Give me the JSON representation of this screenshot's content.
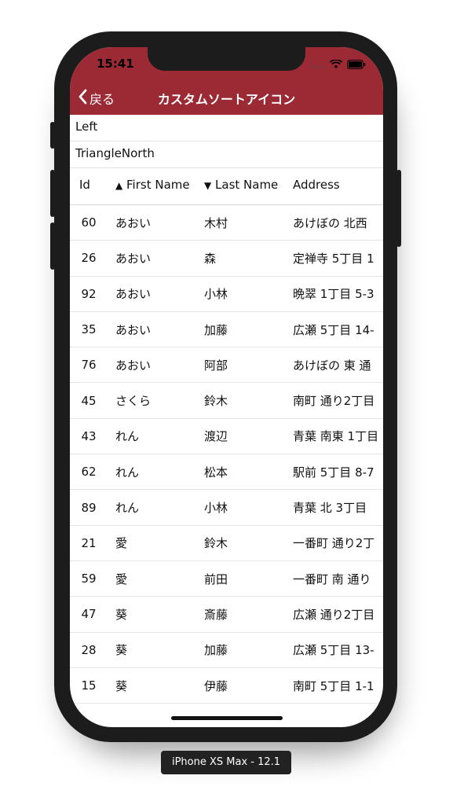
{
  "status": {
    "time": "15:41"
  },
  "nav": {
    "back_label": "戻る",
    "title": "カスタムソートアイコン"
  },
  "options": {
    "position": "Left",
    "icon": "TriangleNorth"
  },
  "table": {
    "headers": {
      "id": "Id",
      "first_arrow": "▲",
      "first": "First Name",
      "last_arrow": "▼",
      "last": "Last Name",
      "address": "Address"
    },
    "rows": [
      {
        "id": "60",
        "first": "あおい",
        "last": "木村",
        "address": "あけぼの 北西"
      },
      {
        "id": "26",
        "first": "あおい",
        "last": "森",
        "address": "定禅寺 5丁目 1"
      },
      {
        "id": "92",
        "first": "あおい",
        "last": "小林",
        "address": "晩翠 1丁目 5-3"
      },
      {
        "id": "35",
        "first": "あおい",
        "last": "加藤",
        "address": "広瀬 5丁目 14-"
      },
      {
        "id": "76",
        "first": "あおい",
        "last": "阿部",
        "address": "あけぼの 東 通"
      },
      {
        "id": "45",
        "first": "さくら",
        "last": "鈴木",
        "address": "南町 通り2丁目"
      },
      {
        "id": "43",
        "first": "れん",
        "last": "渡辺",
        "address": "青葉 南東 1丁目"
      },
      {
        "id": "62",
        "first": "れん",
        "last": "松本",
        "address": "駅前 5丁目 8-7"
      },
      {
        "id": "89",
        "first": "れん",
        "last": "小林",
        "address": "青葉 北 3丁目"
      },
      {
        "id": "21",
        "first": "愛",
        "last": "鈴木",
        "address": "一番町 通り2丁"
      },
      {
        "id": "59",
        "first": "愛",
        "last": "前田",
        "address": "一番町 南 通り"
      },
      {
        "id": "47",
        "first": "葵",
        "last": "斎藤",
        "address": "広瀬 通り2丁目"
      },
      {
        "id": "28",
        "first": "葵",
        "last": "加藤",
        "address": "広瀬 5丁目 13-"
      },
      {
        "id": "15",
        "first": "葵",
        "last": "伊藤",
        "address": "南町 5丁目 1-1"
      }
    ]
  },
  "device_label": "iPhone XS Max - 12.1",
  "colors": {
    "navbar": "#9b2a35"
  }
}
